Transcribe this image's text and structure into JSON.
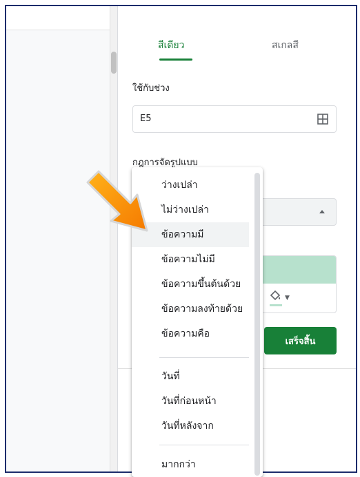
{
  "panel": {
    "tabs": [
      {
        "label": "สีเดียว",
        "active": true
      },
      {
        "label": "สเกลสี",
        "active": false
      }
    ],
    "range_label": "ใช้กับช่วง",
    "range_value": "E5",
    "rules_label": "กฎการจัดรูปแบบ",
    "done_label": "เสร็จสิ้น",
    "preview_color": "#b7e1cd",
    "accent_color": "#188038"
  },
  "menu": {
    "items": [
      {
        "label": "ว่างเปล่า"
      },
      {
        "label": "ไม่ว่างเปล่า"
      },
      {
        "label": "ข้อความมี",
        "hover": true
      },
      {
        "label": "ข้อความไม่มี"
      },
      {
        "label": "ข้อความขึ้นต้นด้วย"
      },
      {
        "label": "ข้อความลงท้ายด้วย"
      },
      {
        "label": "ข้อความคือ"
      },
      {
        "label": "วันที่"
      },
      {
        "label": "วันที่ก่อนหน้า"
      },
      {
        "label": "วันที่หลังจาก"
      },
      {
        "label": "มากกว่า"
      }
    ]
  },
  "icons": {
    "range_grid": "grid-icon",
    "fill": "paint-bucket-icon",
    "annotation": "orange-arrow-icon"
  }
}
